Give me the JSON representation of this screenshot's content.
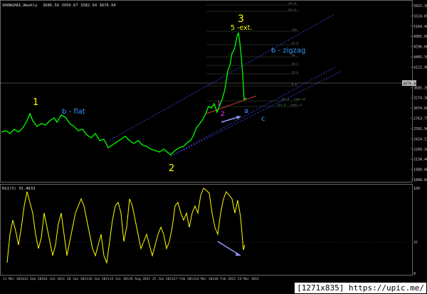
{
  "window": {
    "symbol_line": "SHANGHAI,Weekly",
    "ohlc": "3686.56 3950.67 3382.94 3870.94",
    "rsi_title": "RSI(5) 35.4633",
    "current_price": "3870.94",
    "rsi_level": "37"
  },
  "price_axis": [
    "5915.30",
    "5524.85",
    "5184.40",
    "4965.00",
    "4596.08",
    "4405.35",
    "4115.90",
    "3870.94",
    "3605.35",
    "3274.30",
    "3074.60",
    "2763.75",
    "2591.90",
    "2424.15",
    "2269.16",
    "2134.40",
    "1980.80",
    "1808.85"
  ],
  "rsi_axis": [
    "100",
    "37",
    "0"
  ],
  "date_axis": [
    "11 Mar 2010",
    "12 Sep 2010",
    "1 Jun 2011",
    "26 Jan 2011",
    "16 Jun 2011",
    "15 Jul 2012",
    "8 Aug 2012",
    "25 Jan 2013",
    "27 Feb 2013",
    "14 Mar 2014",
    "8 Feb 2015",
    "24 Mar 2015"
  ],
  "fib_labels": [
    "261.8",
    "361.8",
    "100",
    "61.8",
    "50",
    "38.2",
    "23.6",
    "0.0",
    "161.8 - 3664.46",
    "261.8 - 3983.11"
  ],
  "annotations": {
    "wave1": "1",
    "wave2": "2",
    "wave3": "3",
    "wave3_note": "5 -ext.",
    "b_flat": "b - flat",
    "b_zigzag": "b - zigzag",
    "sub_a": "a",
    "sub_c": "c",
    "sub_1": "1",
    "sub_2": "2"
  },
  "colors": {
    "background": "#000000",
    "price_line": "#00ff00",
    "rsi_line": "#ffff00",
    "channel": "#4a4aff",
    "wave_label": "#ffff00",
    "b_label": "#3399ff",
    "magenta": "#ff33ff",
    "arrow": "#9999ff",
    "trend_red": "#ff4444"
  },
  "footer": {
    "credit": "[1271x835] https://upic.me/"
  }
}
